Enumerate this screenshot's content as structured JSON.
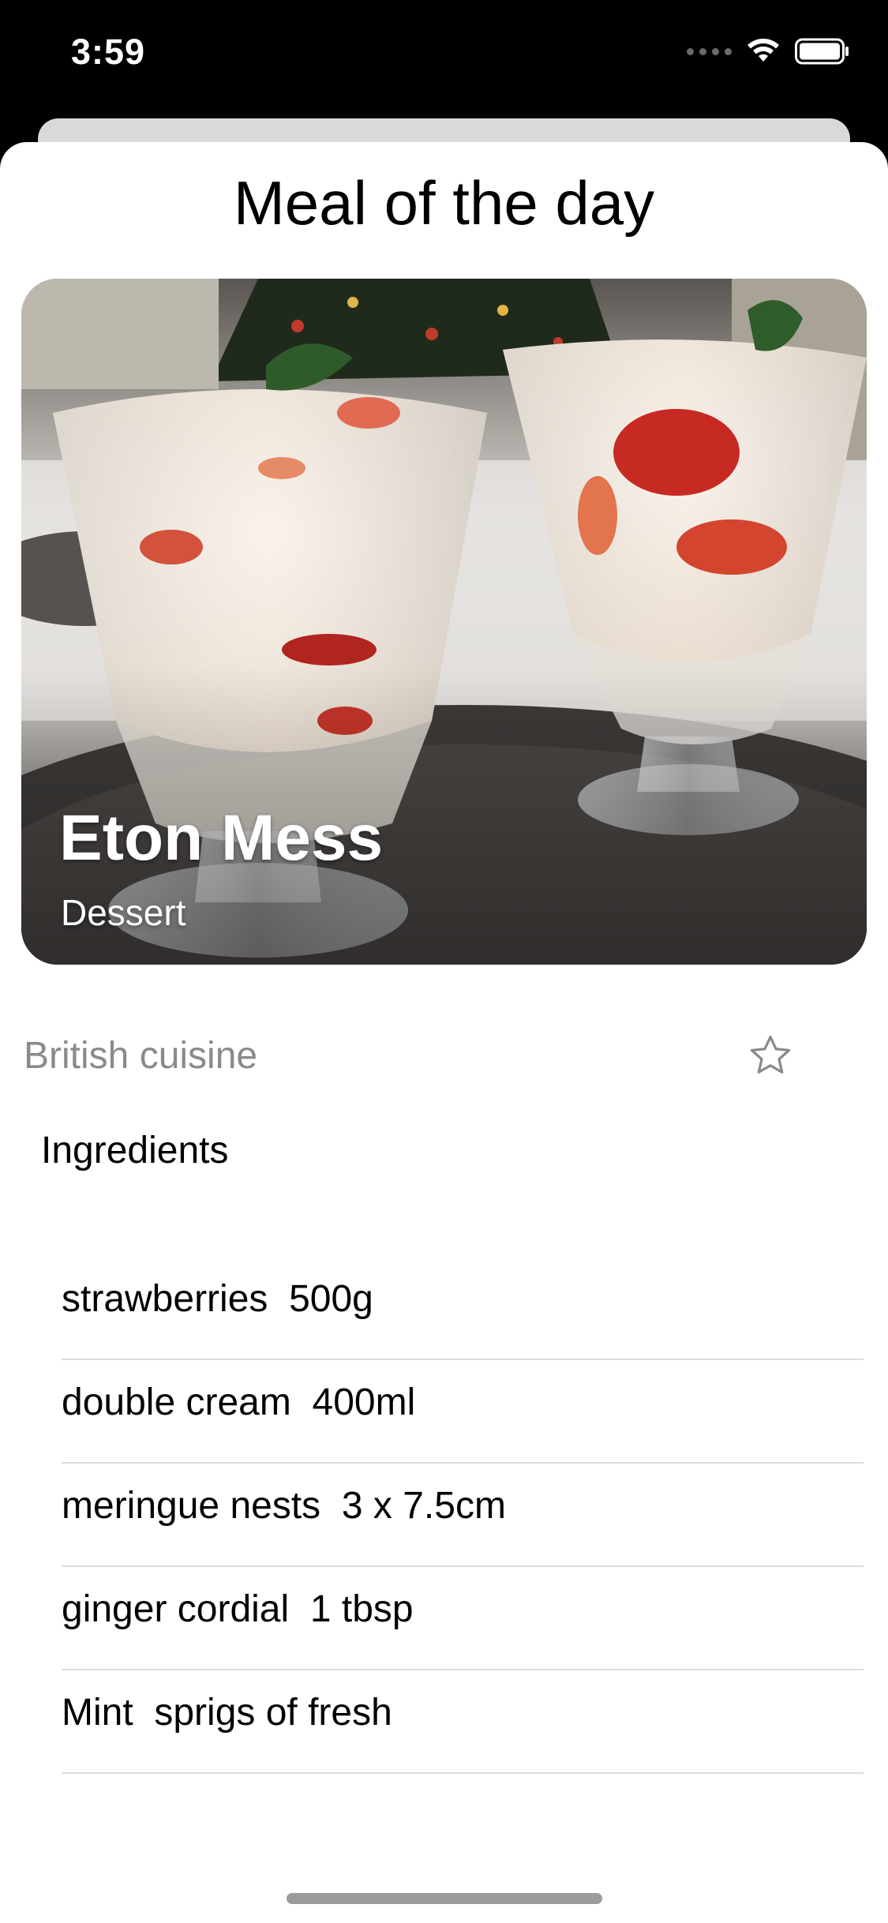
{
  "status_bar": {
    "time": "3:59"
  },
  "sheet": {
    "title": "Meal of the day"
  },
  "meal": {
    "name": "Eton Mess",
    "category": "Dessert",
    "cuisine": "British cuisine",
    "image_alt": "two glasses of Eton Mess dessert on a table"
  },
  "ingredients": {
    "header": "Ingredients",
    "items": [
      {
        "text": "strawberries  500g"
      },
      {
        "text": "double cream  400ml"
      },
      {
        "text": "meringue nests  3 x 7.5cm"
      },
      {
        "text": "ginger cordial  1 tbsp"
      },
      {
        "text": "Mint  sprigs of fresh"
      }
    ]
  },
  "icons": {
    "favorite": "star-outline-icon",
    "wifi": "wifi-icon",
    "battery": "battery-icon",
    "signal": "cellular-signal-icon"
  },
  "colors": {
    "background": "#000000",
    "sheet": "#ffffff",
    "secondary_text": "#8a8a8e",
    "separator": "#dcdcdf"
  }
}
